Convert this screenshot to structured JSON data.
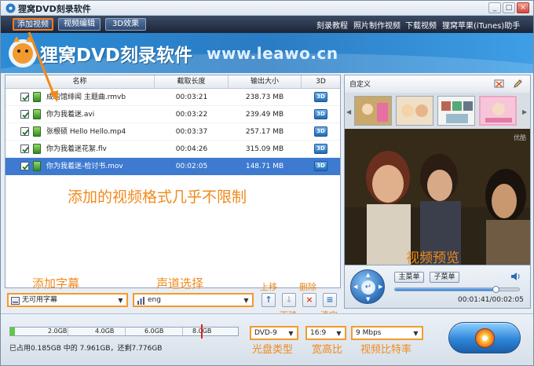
{
  "window": {
    "title": "狸窝DVD刻录软件",
    "controls": [
      "_",
      "□",
      "×"
    ]
  },
  "menu": {
    "tabs": [
      {
        "label": "添加视频",
        "active": true
      },
      {
        "label": "视频编辑",
        "active": false
      },
      {
        "label": "3D效果",
        "active": false
      }
    ],
    "links": [
      "刻录教程",
      "照片制作视频",
      "下载视频",
      "狸窝苹果(iTunes)助手"
    ]
  },
  "banner": {
    "title": "狸窝DVD刻录软件",
    "url": "www.leawo.cn"
  },
  "file_table": {
    "columns": [
      "名称",
      "截取长度",
      "输出大小",
      "3D"
    ],
    "rows": [
      {
        "name": "成均馆绯闻 主题曲.rmvb",
        "duration": "00:03:21",
        "size": "238.73 MB",
        "badge": "3D",
        "selected": false
      },
      {
        "name": "你为我着迷.avi",
        "duration": "00:03:22",
        "size": "239.49 MB",
        "badge": "3D",
        "selected": false
      },
      {
        "name": "张根硕 Hello Hello.mp4",
        "duration": "00:03:37",
        "size": "257.17 MB",
        "badge": "3D",
        "selected": false
      },
      {
        "name": "你为我着迷花絮.flv",
        "duration": "00:04:26",
        "size": "315.09 MB",
        "badge": "3D",
        "selected": false
      },
      {
        "name": "你为我着迷-检讨书.mov",
        "duration": "00:02:05",
        "size": "148.71 MB",
        "badge": "3D",
        "selected": true
      }
    ]
  },
  "annotations": {
    "format_hint": "添加的视频格式几乎不限制",
    "subtitle": "添加字幕",
    "audio": "声道选择",
    "move_up": "上移",
    "move_down": "下移",
    "delete": "删除",
    "clear": "清空",
    "preview": "视频预览",
    "disc_type": "光盘类型",
    "aspect": "宽高比",
    "bitrate": "视频比特率"
  },
  "subtitle_select": {
    "value": "无可用字幕"
  },
  "audio_select": {
    "value": "eng"
  },
  "list_buttons": {
    "up": "↑",
    "down": "↓",
    "delete": "×",
    "clear": "≡"
  },
  "template": {
    "name": "自定义"
  },
  "preview": {
    "watermark": "优酷",
    "time_current": "00:01:41",
    "time_total": "00:02:05",
    "progress": 0.81,
    "main_menu_button": "主菜单",
    "sub_menu_button": "子菜单"
  },
  "capacity": {
    "ticks": [
      "2.0GB",
      "4.0GB",
      "6.0GB",
      "8.0GB"
    ],
    "used_fraction": 0.02,
    "info": "已占用0.185GB 中的 7.961GB，还剩7.776GB"
  },
  "output": {
    "disc_type": "DVD-9",
    "aspect": "16:9",
    "bitrate": "9 Mbps"
  },
  "colors": {
    "accent": "#f08a1c",
    "selection": "#3d7ad0",
    "banner": "#2a7cc3"
  }
}
